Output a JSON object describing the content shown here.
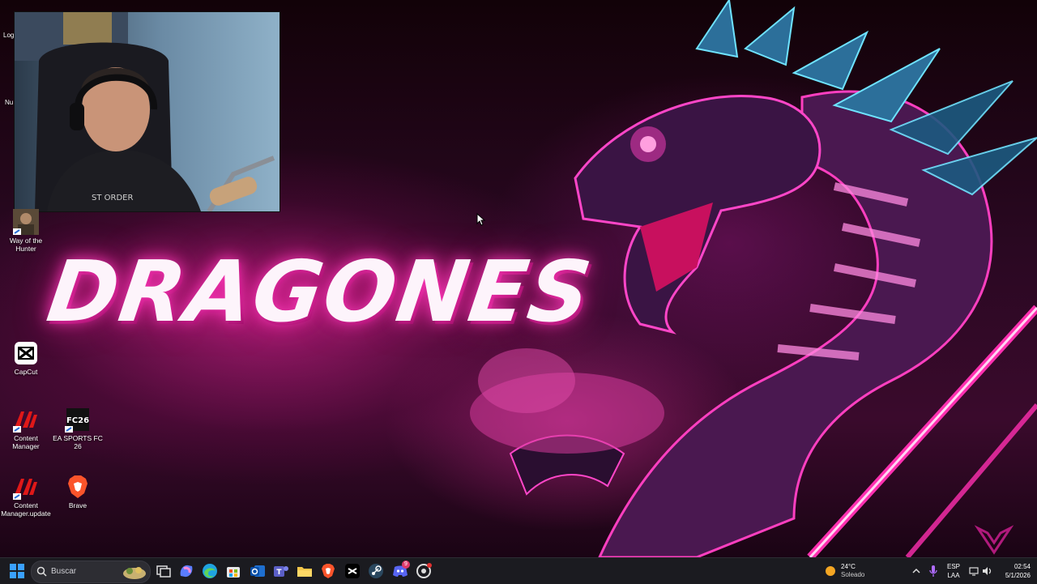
{
  "wallpaper": {
    "title": "DRAGONES",
    "accent_color": "#ff2fb0",
    "secondary_color": "#3ad0ff"
  },
  "webcam": {
    "label": "Log"
  },
  "edge_fragments": {
    "top": "Nu"
  },
  "desktop_icons": [
    {
      "label": "Way of the Hunter",
      "icon": "game-thumbnail-icon"
    },
    {
      "label": "CapCut",
      "icon": "capcut-icon"
    },
    {
      "label": "Content Manager",
      "icon": "content-manager-icon"
    },
    {
      "label": "EA SPORTS FC 26",
      "icon": "ea-fc-icon"
    },
    {
      "label": "Content Manager.update",
      "icon": "content-manager-icon"
    },
    {
      "label": "Brave",
      "icon": "brave-icon"
    }
  ],
  "taskbar": {
    "search_placeholder": "Buscar",
    "pinned": [
      "windows-start-icon",
      "task-view-icon",
      "copilot-icon",
      "edge-icon",
      "store-icon",
      "outlook-icon",
      "teams-icon",
      "file-explorer-icon",
      "brave-icon",
      "capcut-icon",
      "steam-icon",
      "discord-icon",
      "settings-icon"
    ],
    "discord_badge": "9",
    "weather": {
      "temp": "24°C",
      "condition": "Soleado"
    },
    "language": {
      "lang": "ESP",
      "layout": "LAA"
    },
    "clock": {
      "time": "02:54",
      "date": "5/1/2026"
    }
  }
}
